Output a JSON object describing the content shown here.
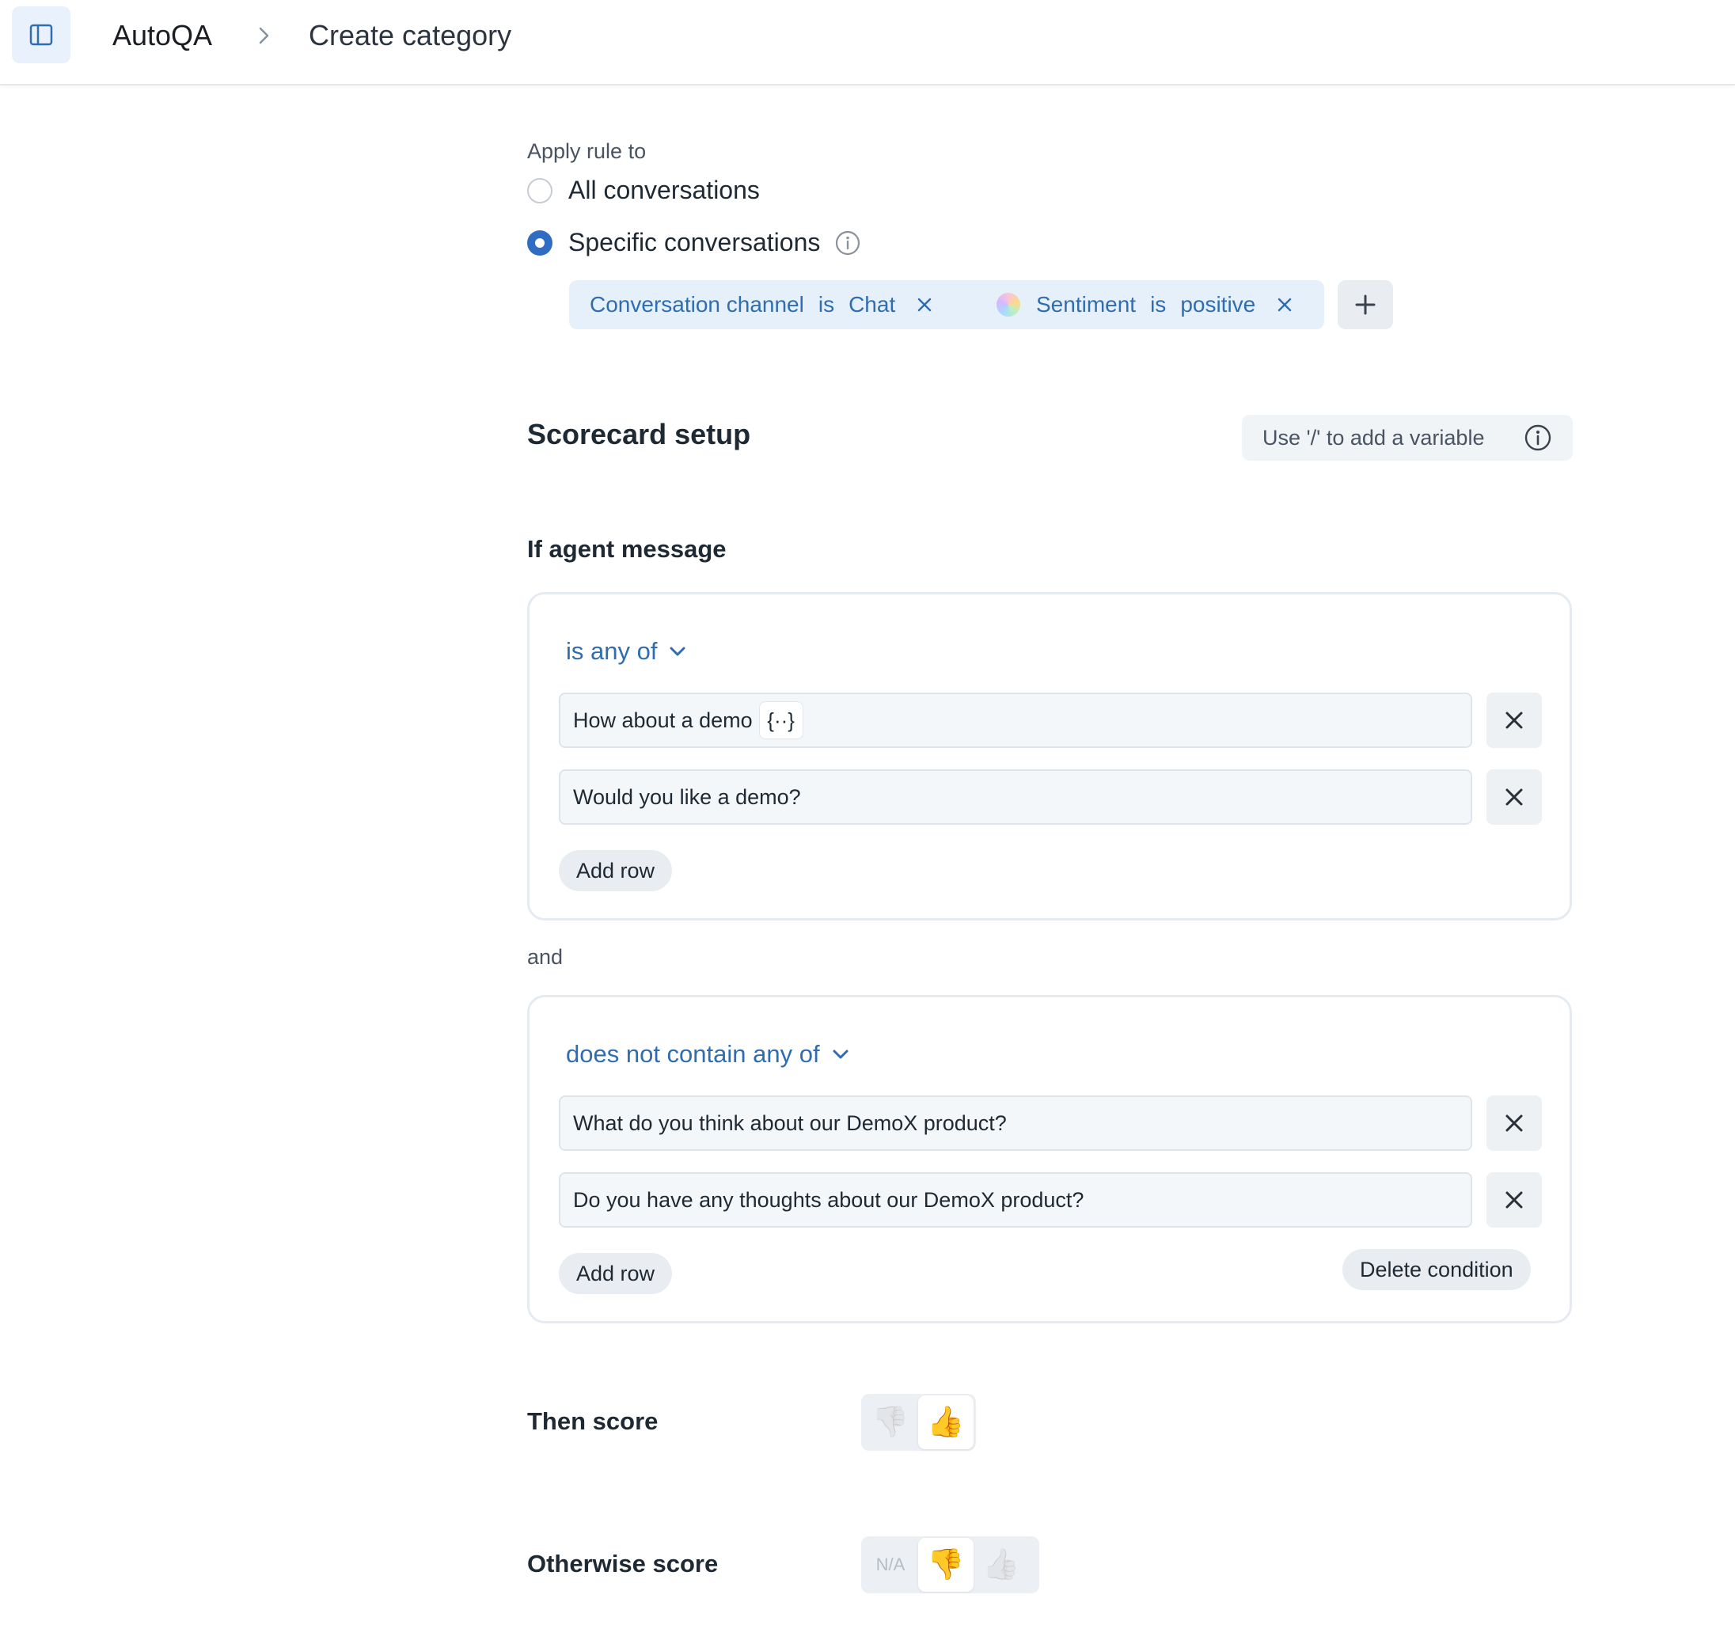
{
  "header": {
    "app_name": "AutoQA",
    "page_title": "Create category"
  },
  "apply_rule": {
    "label": "Apply rule to",
    "options": [
      {
        "label": "All conversations",
        "selected": false
      },
      {
        "label": "Specific conversations",
        "selected": true
      }
    ]
  },
  "filters": [
    {
      "field": "Conversation channel",
      "operator": "is",
      "value": "Chat"
    },
    {
      "field": "Sentiment",
      "operator": "is",
      "value": "positive"
    }
  ],
  "scorecard": {
    "title": "Scorecard setup",
    "variable_hint": "Use '/' to add a variable"
  },
  "if_agent": {
    "label": "If agent message",
    "conditions": [
      {
        "operator": "is any of",
        "rows": [
          "How about a demo",
          "Would you like a demo?"
        ],
        "variable_token": "{··}",
        "add_row_label": "Add row"
      },
      {
        "operator": "does not contain any of",
        "rows": [
          "What do you think about our DemoX product?",
          "Do you have any thoughts about our DemoX product?"
        ],
        "add_row_label": "Add row",
        "delete_label": "Delete condition"
      }
    ],
    "joiner": "and"
  },
  "then_score": {
    "label": "Then score",
    "options": [
      {
        "icon": "thumbs-down",
        "glyph": "👎",
        "active": false
      },
      {
        "icon": "thumbs-up",
        "glyph": "👍",
        "active": true
      }
    ]
  },
  "otherwise_score": {
    "label": "Otherwise score",
    "options": [
      {
        "label": "N/A",
        "active": false
      },
      {
        "icon": "thumbs-down",
        "glyph": "👎",
        "active": true
      },
      {
        "icon": "thumbs-up",
        "glyph": "👍",
        "active": false
      }
    ]
  },
  "colors": {
    "accent": "#2f6dc4",
    "chip_bg": "#e6f0fb",
    "chip_text": "#2f6db0"
  }
}
